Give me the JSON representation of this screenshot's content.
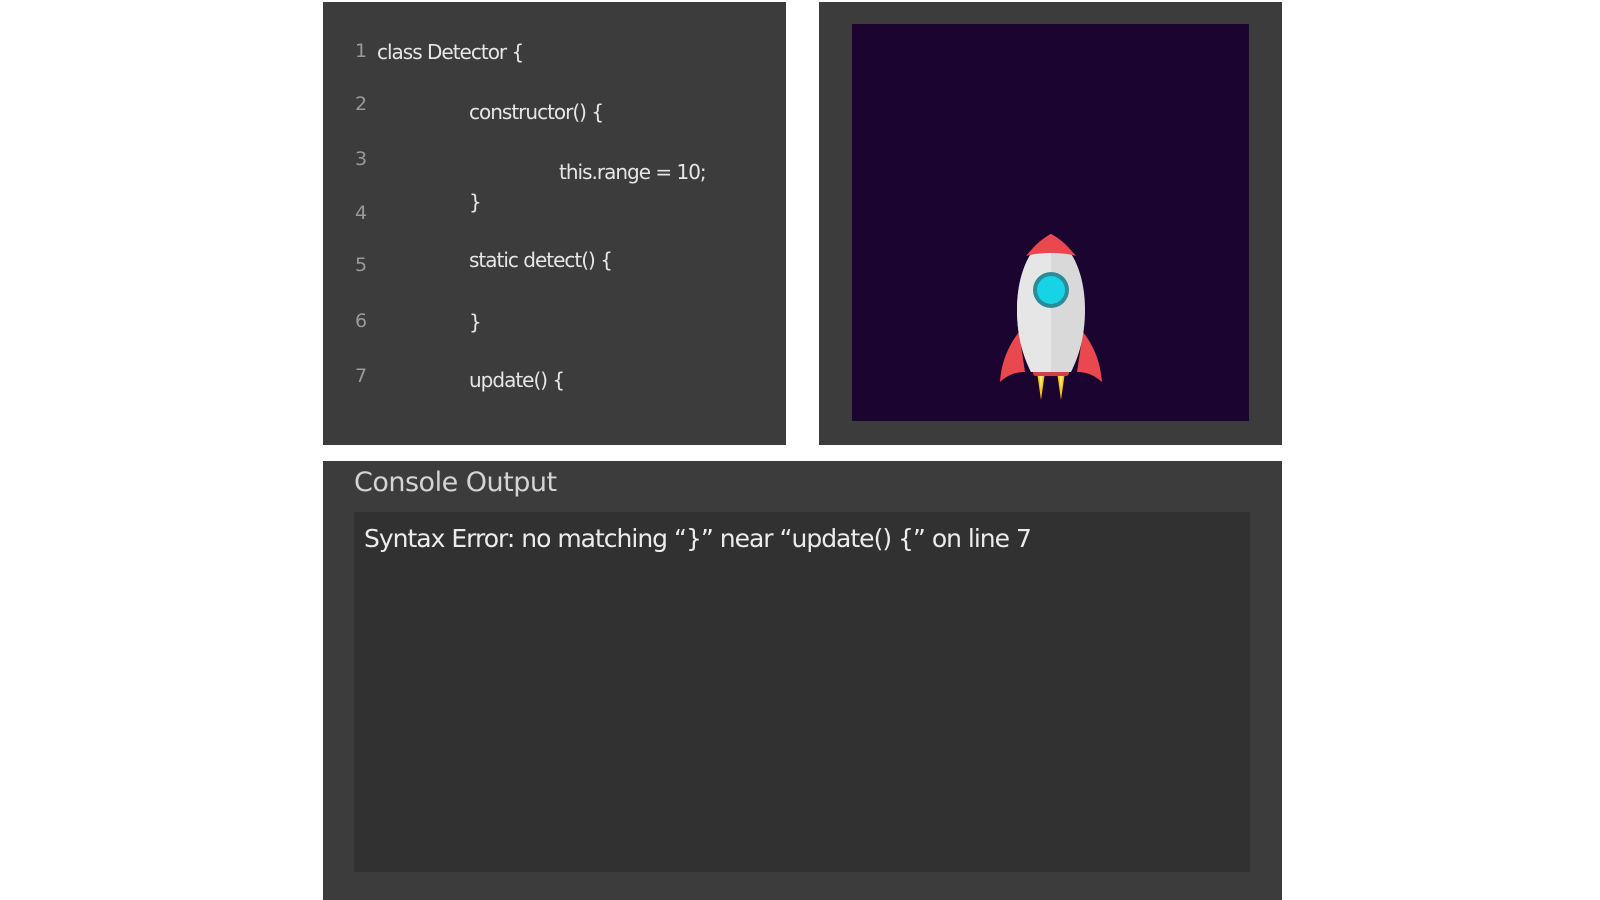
{
  "editor": {
    "lines": [
      {
        "number": "1",
        "code": "class Detector {"
      },
      {
        "number": "2",
        "code": "constructor() {"
      },
      {
        "number": "3",
        "code": "this.range = 10;"
      },
      {
        "number": "4",
        "code": "}"
      },
      {
        "number": "5",
        "code": "static detect() {"
      },
      {
        "number": "6",
        "code": "}"
      },
      {
        "number": "7",
        "code": "update() {"
      }
    ]
  },
  "preview": {
    "background_color": "#1b0430",
    "sprite": "rocket-icon"
  },
  "console": {
    "title": "Console Output",
    "message": "Syntax Error: no matching “}” near “update() {” on line 7"
  },
  "colors": {
    "panel": "#3c3c3c",
    "console_box": "#313131",
    "rocket_body": "#e0e0e0",
    "rocket_fins": "#e8484e",
    "rocket_window": "#16d3e6",
    "rocket_flame": "#f5c518"
  }
}
